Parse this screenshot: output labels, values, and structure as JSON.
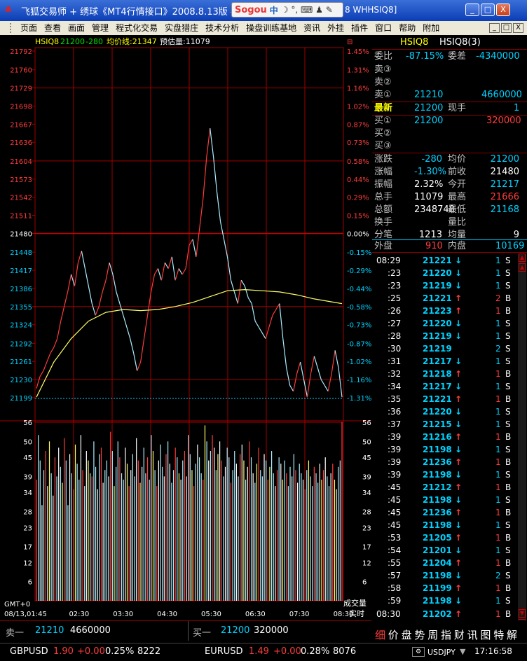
{
  "window": {
    "title": "飞狐交易师 + 绣球《MT4行情接口》2008.8.13版 -",
    "right_title": "8 WHHSIQ8]",
    "sogou": {
      "brand": "Sogou",
      "mode": "中",
      "icons": "☽ °, ⌨ ♟ ✎"
    },
    "buttons": {
      "minimize": "_",
      "maximize": "□",
      "close": "X"
    }
  },
  "menu": {
    "items": [
      "页面",
      "查看",
      "画面",
      "管理",
      "程式化交易",
      "实盘猎庄",
      "技术分析",
      "操盘训练基地",
      "资讯",
      "外挂",
      "插件",
      "窗口",
      "帮助",
      "附加"
    ],
    "right_buttons": [
      "_",
      "□",
      "X"
    ]
  },
  "chart_header": {
    "symbol": "HSIQ8",
    "price": "21200",
    "change": "-280",
    "avg_label": "均价线:21347",
    "est_label": "预估量:11079"
  },
  "chart_data": {
    "type": "line",
    "y_left_ticks": [
      21792,
      21760,
      21729,
      21698,
      21667,
      21636,
      21604,
      21573,
      21542,
      21511,
      21480,
      21448,
      21417,
      21386,
      21355,
      21324,
      21292,
      21261,
      21230,
      21199
    ],
    "y_right_ticks": [
      "1.45%",
      "1.31%",
      "1.16%",
      "1.02%",
      "0.87%",
      "0.73%",
      "0.58%",
      "0.44%",
      "0.29%",
      "0.15%",
      "0.00%",
      "-0.15%",
      "-0.29%",
      "-0.44%",
      "-0.58%",
      "-0.73%",
      "-0.87%",
      "-1.02%",
      "-1.16%",
      "-1.31%"
    ],
    "ylim": [
      21199,
      21792
    ],
    "prev_close": 21480,
    "x_ticks": [
      "08/13,01:45",
      "02:30",
      "03:30",
      "04:30",
      "05:30",
      "06:30",
      "07:30",
      "08:30"
    ],
    "price_series": [
      [
        0,
        21215
      ],
      [
        2,
        21235
      ],
      [
        4,
        21245
      ],
      [
        6,
        21260
      ],
      [
        8,
        21275
      ],
      [
        10,
        21285
      ],
      [
        12,
        21300
      ],
      [
        14,
        21330
      ],
      [
        16,
        21355
      ],
      [
        18,
        21380
      ],
      [
        20,
        21410
      ],
      [
        22,
        21390
      ],
      [
        24,
        21430
      ],
      [
        26,
        21450
      ],
      [
        28,
        21420
      ],
      [
        30,
        21390
      ],
      [
        32,
        21360
      ],
      [
        34,
        21340
      ],
      [
        36,
        21355
      ],
      [
        38,
        21380
      ],
      [
        40,
        21400
      ],
      [
        42,
        21430
      ],
      [
        44,
        21410
      ],
      [
        46,
        21380
      ],
      [
        48,
        21360
      ],
      [
        50,
        21340
      ],
      [
        52,
        21320
      ],
      [
        54,
        21300
      ],
      [
        56,
        21275
      ],
      [
        58,
        21245
      ],
      [
        60,
        21260
      ],
      [
        62,
        21300
      ],
      [
        64,
        21340
      ],
      [
        66,
        21380
      ],
      [
        68,
        21410
      ],
      [
        70,
        21420
      ],
      [
        72,
        21400
      ],
      [
        74,
        21430
      ],
      [
        76,
        21420
      ],
      [
        78,
        21440
      ],
      [
        80,
        21400
      ],
      [
        82,
        21420
      ],
      [
        84,
        21410
      ],
      [
        86,
        21420
      ],
      [
        88,
        21460
      ],
      [
        90,
        21470
      ],
      [
        92,
        21440
      ],
      [
        94,
        21490
      ],
      [
        96,
        21540
      ],
      [
        98,
        21610
      ],
      [
        100,
        21660
      ],
      [
        102,
        21610
      ],
      [
        104,
        21550
      ],
      [
        106,
        21500
      ],
      [
        108,
        21470
      ],
      [
        110,
        21440
      ],
      [
        112,
        21400
      ],
      [
        114,
        21380
      ],
      [
        116,
        21360
      ],
      [
        118,
        21400
      ],
      [
        120,
        21390
      ],
      [
        122,
        21370
      ],
      [
        124,
        21360
      ],
      [
        126,
        21330
      ],
      [
        128,
        21320
      ],
      [
        130,
        21310
      ],
      [
        132,
        21300
      ],
      [
        134,
        21320
      ],
      [
        136,
        21340
      ],
      [
        138,
        21350
      ],
      [
        140,
        21360
      ],
      [
        142,
        21300
      ],
      [
        144,
        21250
      ],
      [
        146,
        21220
      ],
      [
        148,
        21210
      ],
      [
        150,
        21240
      ],
      [
        152,
        21260
      ],
      [
        154,
        21230
      ],
      [
        156,
        21200
      ],
      [
        158,
        21240
      ],
      [
        160,
        21270
      ],
      [
        162,
        21250
      ],
      [
        164,
        21230
      ],
      [
        166,
        21220
      ],
      [
        168,
        21210
      ],
      [
        170,
        21240
      ],
      [
        172,
        21280
      ],
      [
        174,
        21250
      ],
      [
        176,
        21200
      ]
    ],
    "avg_series": [
      [
        0,
        21200
      ],
      [
        10,
        21260
      ],
      [
        20,
        21300
      ],
      [
        30,
        21330
      ],
      [
        40,
        21345
      ],
      [
        50,
        21350
      ],
      [
        60,
        21348
      ],
      [
        70,
        21350
      ],
      [
        80,
        21355
      ],
      [
        90,
        21362
      ],
      [
        100,
        21372
      ],
      [
        110,
        21382
      ],
      [
        120,
        21384
      ],
      [
        130,
        21382
      ],
      [
        140,
        21380
      ],
      [
        150,
        21375
      ],
      [
        160,
        21368
      ],
      [
        176,
        21360
      ]
    ],
    "volume_ylim": [
      0,
      56
    ],
    "volume_left_ticks": [
      56,
      50,
      45,
      39,
      34,
      28,
      23,
      17,
      12,
      6
    ],
    "volume_right_ticks": [
      56,
      50,
      45,
      39,
      34,
      28,
      23,
      17,
      12,
      6
    ],
    "volume_label": "成交量",
    "realtime_label": "实时",
    "volume_series": [
      38,
      52,
      44,
      30,
      41,
      47,
      36,
      50,
      40,
      33,
      45,
      39,
      48,
      42,
      37,
      51,
      44,
      30,
      46,
      40,
      35,
      49,
      43,
      38,
      52,
      41,
      36,
      47,
      44,
      40,
      39,
      50,
      42,
      35,
      46,
      48,
      37,
      41,
      44,
      39,
      53,
      47,
      36,
      42,
      50,
      45,
      40,
      38,
      48,
      43,
      36,
      41,
      46,
      39,
      51,
      44,
      37,
      42,
      48,
      40,
      45,
      38,
      52,
      47,
      41,
      36,
      44,
      49,
      42,
      39,
      46,
      50,
      43,
      37,
      41,
      48,
      45,
      40,
      38,
      44,
      47,
      39,
      52,
      46,
      41,
      36,
      43,
      49,
      45,
      40,
      38,
      55,
      50,
      44,
      47,
      52,
      48,
      41,
      46,
      50,
      44,
      39,
      42,
      48,
      45,
      37,
      41,
      47,
      43,
      39,
      46,
      49,
      44,
      38,
      42,
      50,
      45,
      40,
      37,
      43,
      48,
      41,
      39,
      46,
      44,
      38,
      42,
      47,
      40,
      36,
      41,
      45,
      43,
      38,
      44,
      40,
      36,
      42,
      39,
      46,
      41,
      37,
      43,
      40,
      38,
      35,
      41,
      44,
      39,
      36,
      42,
      40,
      37,
      43,
      38,
      41,
      45,
      39,
      36,
      40,
      43,
      38,
      35,
      42,
      44,
      56
    ]
  },
  "quote": {
    "header": {
      "title": "HSIQ8",
      "code": "HSIQ8(3)"
    },
    "weibi": {
      "label": "委比",
      "value": "-87.15%",
      "label2": "委差",
      "value2": "-4340000"
    },
    "sell3": {
      "label": "卖③"
    },
    "sell2": {
      "label": "卖②"
    },
    "sell1": {
      "label": "卖①",
      "price": "21210",
      "vol": "4660000"
    },
    "latest": {
      "label": "最新",
      "price": "21200",
      "label2": "现手",
      "value2": "1"
    },
    "buy1": {
      "label": "买①",
      "price": "21200",
      "vol": "320000"
    },
    "buy2": {
      "label": "买②"
    },
    "buy3": {
      "label": "买③"
    },
    "stats": [
      {
        "l1": "涨跌",
        "v1": "-280",
        "l2": "均价",
        "v2": "21200"
      },
      {
        "l1": "涨幅",
        "v1": "-1.30%",
        "l2": "前收",
        "v2": "21480"
      },
      {
        "l1": "振幅",
        "v1": "2.32%",
        "l2": "今开",
        "v2": "21217"
      },
      {
        "l1": "总手",
        "v1": "11079",
        "l2": "最高",
        "v2": "21666"
      },
      {
        "l1": "总额",
        "v1": "2348748",
        "l2": "最低",
        "v2": "21168"
      },
      {
        "l1": "换手",
        "v1": "",
        "l2": "量比",
        "v2": ""
      },
      {
        "l1": "分笔",
        "v1": "1213",
        "l2": "均量",
        "v2": "9"
      }
    ],
    "outer": {
      "label": "外盘",
      "value": "910",
      "label2": "内盘",
      "value2": "10169"
    },
    "ticks": [
      {
        "t": "08:29",
        "p": "21221",
        "d": "↓",
        "v": "1",
        "s": "S"
      },
      {
        "t": ":23",
        "p": "21220",
        "d": "↓",
        "v": "1",
        "s": "S"
      },
      {
        "t": ":23",
        "p": "21219",
        "d": "↓",
        "v": "1",
        "s": "S"
      },
      {
        "t": ":25",
        "p": "21221",
        "d": "↑",
        "v": "2",
        "s": "B"
      },
      {
        "t": ":26",
        "p": "21223",
        "d": "↑",
        "v": "1",
        "s": "B"
      },
      {
        "t": ":27",
        "p": "21220",
        "d": "↓",
        "v": "1",
        "s": "S"
      },
      {
        "t": ":28",
        "p": "21219",
        "d": "↓",
        "v": "1",
        "s": "S"
      },
      {
        "t": ":30",
        "p": "21219",
        "d": "",
        "v": "2",
        "s": "S"
      },
      {
        "t": ":31",
        "p": "21217",
        "d": "↓",
        "v": "1",
        "s": "S"
      },
      {
        "t": ":32",
        "p": "21218",
        "d": "↑",
        "v": "1",
        "s": "B"
      },
      {
        "t": ":34",
        "p": "21217",
        "d": "↓",
        "v": "1",
        "s": "S"
      },
      {
        "t": ":35",
        "p": "21221",
        "d": "↑",
        "v": "1",
        "s": "B"
      },
      {
        "t": ":36",
        "p": "21220",
        "d": "↓",
        "v": "1",
        "s": "S"
      },
      {
        "t": ":37",
        "p": "21215",
        "d": "↓",
        "v": "1",
        "s": "S"
      },
      {
        "t": ":39",
        "p": "21216",
        "d": "↑",
        "v": "1",
        "s": "B"
      },
      {
        "t": ":39",
        "p": "21198",
        "d": "↓",
        "v": "1",
        "s": "S"
      },
      {
        "t": ":39",
        "p": "21236",
        "d": "↑",
        "v": "1",
        "s": "B"
      },
      {
        "t": ":39",
        "p": "21198",
        "d": "↓",
        "v": "1",
        "s": "S"
      },
      {
        "t": ":45",
        "p": "21212",
        "d": "↑",
        "v": "1",
        "s": "B"
      },
      {
        "t": ":45",
        "p": "21198",
        "d": "↓",
        "v": "1",
        "s": "S"
      },
      {
        "t": ":45",
        "p": "21236",
        "d": "↑",
        "v": "1",
        "s": "B"
      },
      {
        "t": ":45",
        "p": "21198",
        "d": "↓",
        "v": "1",
        "s": "S"
      },
      {
        "t": ":53",
        "p": "21205",
        "d": "↑",
        "v": "1",
        "s": "B"
      },
      {
        "t": ":54",
        "p": "21201",
        "d": "↓",
        "v": "1",
        "s": "S"
      },
      {
        "t": ":55",
        "p": "21204",
        "d": "↑",
        "v": "1",
        "s": "B"
      },
      {
        "t": ":57",
        "p": "21198",
        "d": "↓",
        "v": "2",
        "s": "S"
      },
      {
        "t": ":58",
        "p": "21199",
        "d": "↑",
        "v": "1",
        "s": "B"
      },
      {
        "t": ":59",
        "p": "21198",
        "d": "↓",
        "v": "1",
        "s": "S"
      },
      {
        "t": "08:30",
        "p": "21202",
        "d": "↑",
        "v": "1",
        "s": "B"
      }
    ],
    "tabs": [
      "细",
      "价",
      "盘",
      "势",
      "周",
      "指",
      "财",
      "讯",
      "图",
      "特",
      "解"
    ]
  },
  "bottom": {
    "sell1_label": "卖一",
    "sell1_price": "21210",
    "sell1_vol": "4660000",
    "buy1_label": "买一",
    "buy1_price": "21200",
    "buy1_vol": "320000"
  },
  "fx": {
    "gbp": {
      "sym": "GBPUSD",
      "v1": "1.90",
      "chg": "+0.00",
      "pct": "0.25%",
      "n": "8222"
    },
    "eur": {
      "sym": "EURUSD",
      "v1": "1.49",
      "chg": "+0.00",
      "pct": "0.28%",
      "n": "8076"
    },
    "jpy": "USDJPY",
    "clock": "17:16:58"
  }
}
